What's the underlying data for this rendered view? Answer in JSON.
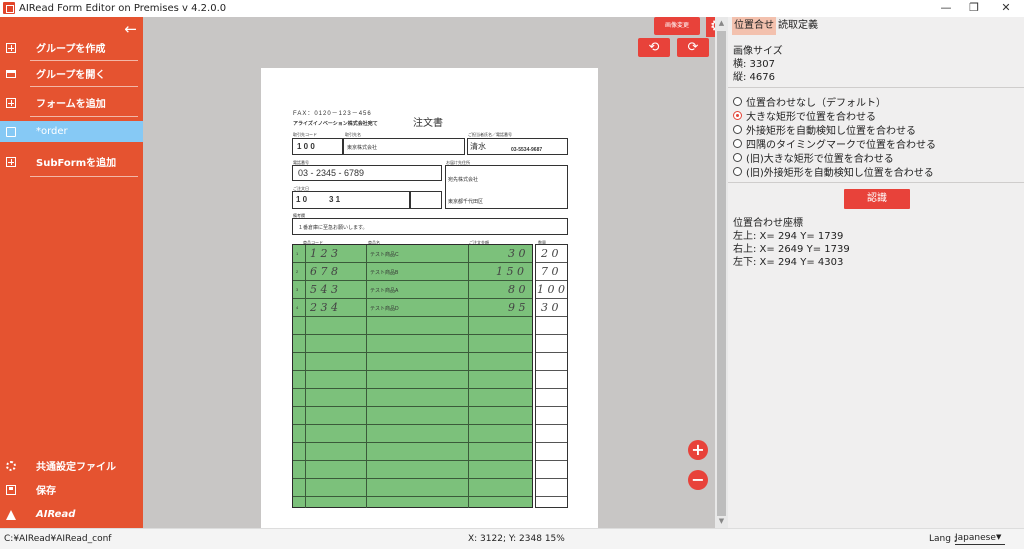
{
  "window": {
    "title": "AIRead Form Editor on Premises v 4.2.0.0",
    "minimize": "—",
    "maximize": "❐",
    "close": "✕"
  },
  "sidebar": {
    "back_icon": "←",
    "items": [
      {
        "label": "グループを作成",
        "icon": "plus-box-icon"
      },
      {
        "label": "グループを開く",
        "icon": "folder-open-icon"
      },
      {
        "label": "フォームを追加",
        "icon": "plus-box-icon"
      },
      {
        "label": "*order",
        "icon": "document-icon",
        "active": true
      },
      {
        "label": "SubFormを追加",
        "icon": "plus-box-icon"
      }
    ],
    "bottom": [
      {
        "label": "共通設定ファイル",
        "icon": "gear-icon"
      },
      {
        "label": "保存",
        "icon": "save-icon"
      },
      {
        "label": "AIRead",
        "icon": "airead-logo-icon"
      }
    ]
  },
  "toolbar": {
    "image_change": "画像変更",
    "rotate_left": "⟲",
    "rotate_right": "⟳",
    "settings_icon": "⚙",
    "zoom_in": "+",
    "zoom_out": "−"
  },
  "document": {
    "fax": "FAX：0120－123－456",
    "title": "注文書",
    "to": "アライズイノベーション株式会社宛て",
    "label_customer_code": "取引先コード",
    "label_customer_name": "取引先名",
    "label_contact": "ご担当者氏名／電話番号",
    "customer_code": "1 0 0",
    "customer_name": "東京株式会社",
    "contact_name": "清水",
    "contact_tel": "03-5534-9687",
    "label_phone": "電話番号",
    "phone": "03 - 2345 - 6789",
    "label_delivery": "お届け先住所",
    "delivery_company": "宛先株式会社",
    "delivery_addr": "東京都千代田区",
    "label_date": "ご注文日",
    "date_value": "1 0",
    "date_day": "3 1",
    "label_remarks": "備考欄",
    "remarks": "１番倉庫に至急お願いします。",
    "label_product_code": "商品コード",
    "label_product_name": "商品名",
    "label_price": "ご注文金額",
    "label_qty": "数量",
    "rows": [
      {
        "no": "1",
        "code": "1 2 3",
        "name": "テスト商品C",
        "price": "3 0",
        "qty": "2 0"
      },
      {
        "no": "2",
        "code": "6 7 8",
        "name": "テスト商品B",
        "price": "1 5 0",
        "qty": "7 0"
      },
      {
        "no": "3",
        "code": "5 4 3",
        "name": "テスト商品A",
        "price": "8 0",
        "qty": "1 0 0"
      },
      {
        "no": "4",
        "code": "2 3 4",
        "name": "テスト商品D",
        "price": "9 5",
        "qty": "3 0"
      }
    ]
  },
  "rpanel": {
    "tabs": [
      "位置合せ",
      "読取定義"
    ],
    "image_size_label": "画像サイズ",
    "width": "横: 3307",
    "height": "縦: 4676",
    "options": [
      {
        "label": "位置合わせなし（デフォルト）",
        "checked": false
      },
      {
        "label": "大きな矩形で位置を合わせる",
        "checked": true
      },
      {
        "label": "外接矩形を自動検知し位置を合わせる",
        "checked": false
      },
      {
        "label": "四隅のタイミングマークで位置を合わせる",
        "checked": false
      },
      {
        "label": "(旧)大きな矩形で位置を合わせる",
        "checked": false
      },
      {
        "label": "(旧)外接矩形を自動検知し位置を合わせる",
        "checked": false
      }
    ],
    "recognize": "認識",
    "coords_label": "位置合わせ座標",
    "top_left": "左上: X= 294   Y= 1739",
    "top_right": "右上: X= 2649   Y= 1739",
    "bottom_left": "左下: X= 294   Y= 4303"
  },
  "status": {
    "path": "C:¥AIRead¥AIRead_conf",
    "coords": "X: 3122; Y: 2348   15%",
    "lang_label": "Lang :",
    "lang_value": "Japanese"
  },
  "colors": {
    "sidebar": "#e55330",
    "accent": "#e8423a",
    "active_item": "#86c9f5",
    "grid_green": "#7cc17b"
  }
}
